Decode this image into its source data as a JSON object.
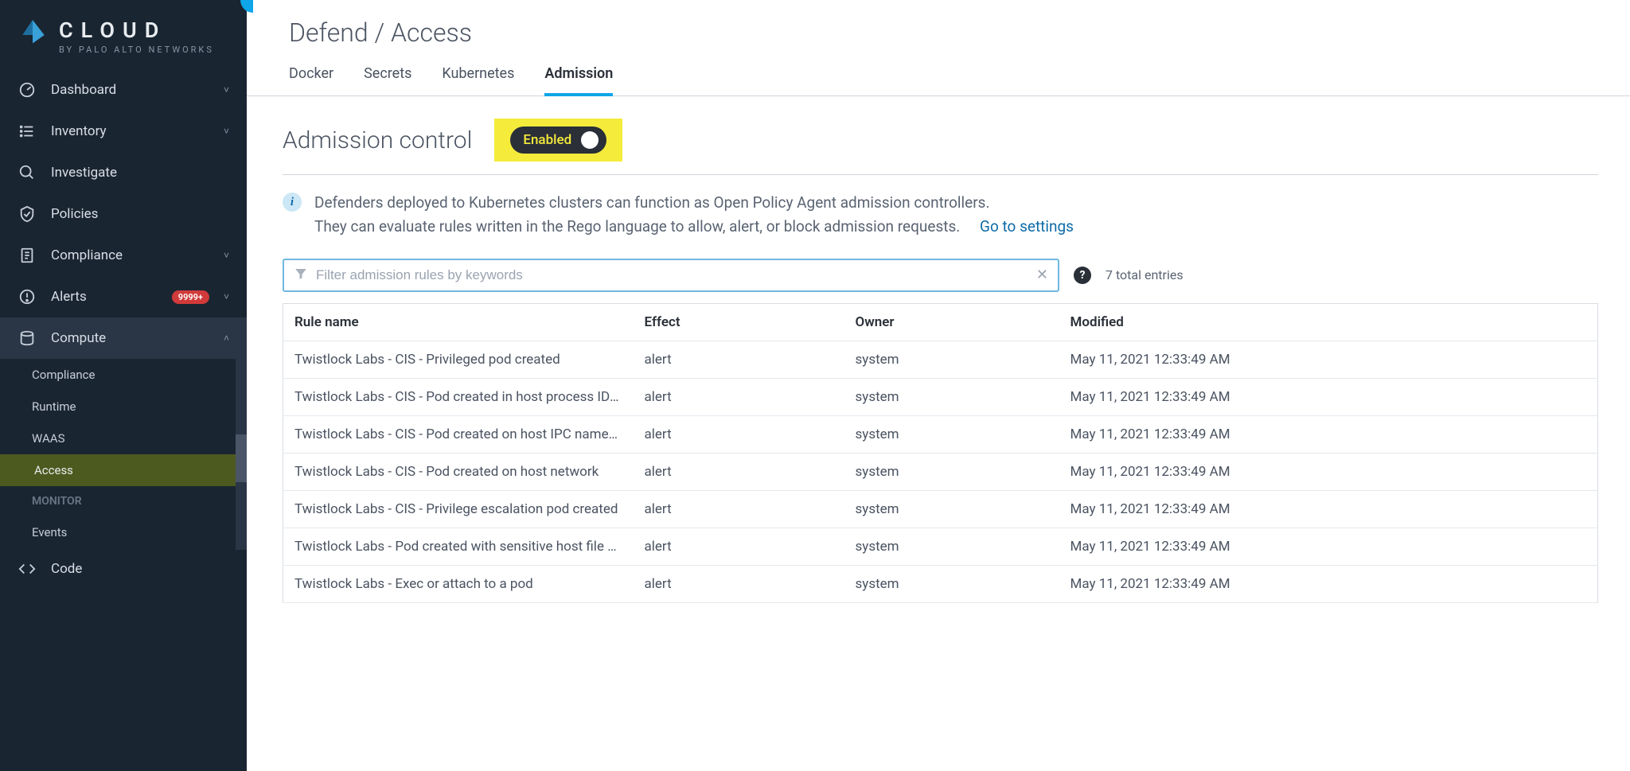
{
  "logo": {
    "main": "CLOUD",
    "sub": "BY PALO ALTO NETWORKS"
  },
  "sidebar": {
    "items": [
      {
        "label": "Dashboard",
        "icon": "gauge",
        "chevron": true
      },
      {
        "label": "Inventory",
        "icon": "list",
        "chevron": true
      },
      {
        "label": "Investigate",
        "icon": "search",
        "chevron": false
      },
      {
        "label": "Policies",
        "icon": "shield",
        "chevron": false
      },
      {
        "label": "Compliance",
        "icon": "doc",
        "chevron": true
      },
      {
        "label": "Alerts",
        "icon": "alert",
        "chevron": true,
        "badge": "9999+"
      },
      {
        "label": "Compute",
        "icon": "compute",
        "chevron": true,
        "expanded": true
      }
    ],
    "sub": [
      {
        "label": "Compliance"
      },
      {
        "label": "Runtime"
      },
      {
        "label": "WAAS"
      },
      {
        "label": "Access",
        "active": true
      },
      {
        "label": "MONITOR",
        "heading": true
      },
      {
        "label": "Events"
      }
    ],
    "bottom": {
      "label": "Code",
      "icon": "code"
    }
  },
  "breadcrumb": "Defend / Access",
  "tabs": [
    {
      "label": "Docker"
    },
    {
      "label": "Secrets"
    },
    {
      "label": "Kubernetes"
    },
    {
      "label": "Admission",
      "active": true
    }
  ],
  "section": {
    "title": "Admission control",
    "toggle_label": "Enabled",
    "info_line1": "Defenders deployed to Kubernetes clusters can function as Open Policy Agent admission controllers.",
    "info_line2": "They can evaluate rules written in the Rego language to allow, alert, or block admission requests.",
    "settings_link": "Go to settings"
  },
  "filter": {
    "placeholder": "Filter admission rules by keywords"
  },
  "total": "7 total entries",
  "columns": {
    "rule": "Rule name",
    "effect": "Effect",
    "owner": "Owner",
    "modified": "Modified"
  },
  "rows": [
    {
      "rule": "Twistlock Labs - CIS - Privileged pod created",
      "effect": "alert",
      "owner": "system",
      "modified": "May 11, 2021 12:33:49 AM"
    },
    {
      "rule": "Twistlock Labs - CIS - Pod created in host process ID ...",
      "effect": "alert",
      "owner": "system",
      "modified": "May 11, 2021 12:33:49 AM"
    },
    {
      "rule": "Twistlock Labs - CIS - Pod created on host IPC names...",
      "effect": "alert",
      "owner": "system",
      "modified": "May 11, 2021 12:33:49 AM"
    },
    {
      "rule": "Twistlock Labs - CIS - Pod created on host network",
      "effect": "alert",
      "owner": "system",
      "modified": "May 11, 2021 12:33:49 AM"
    },
    {
      "rule": "Twistlock Labs - CIS - Privilege escalation pod created",
      "effect": "alert",
      "owner": "system",
      "modified": "May 11, 2021 12:33:49 AM"
    },
    {
      "rule": "Twistlock Labs - Pod created with sensitive host file s...",
      "effect": "alert",
      "owner": "system",
      "modified": "May 11, 2021 12:33:49 AM"
    },
    {
      "rule": "Twistlock Labs - Exec or attach to a pod",
      "effect": "alert",
      "owner": "system",
      "modified": "May 11, 2021 12:33:49 AM"
    }
  ]
}
